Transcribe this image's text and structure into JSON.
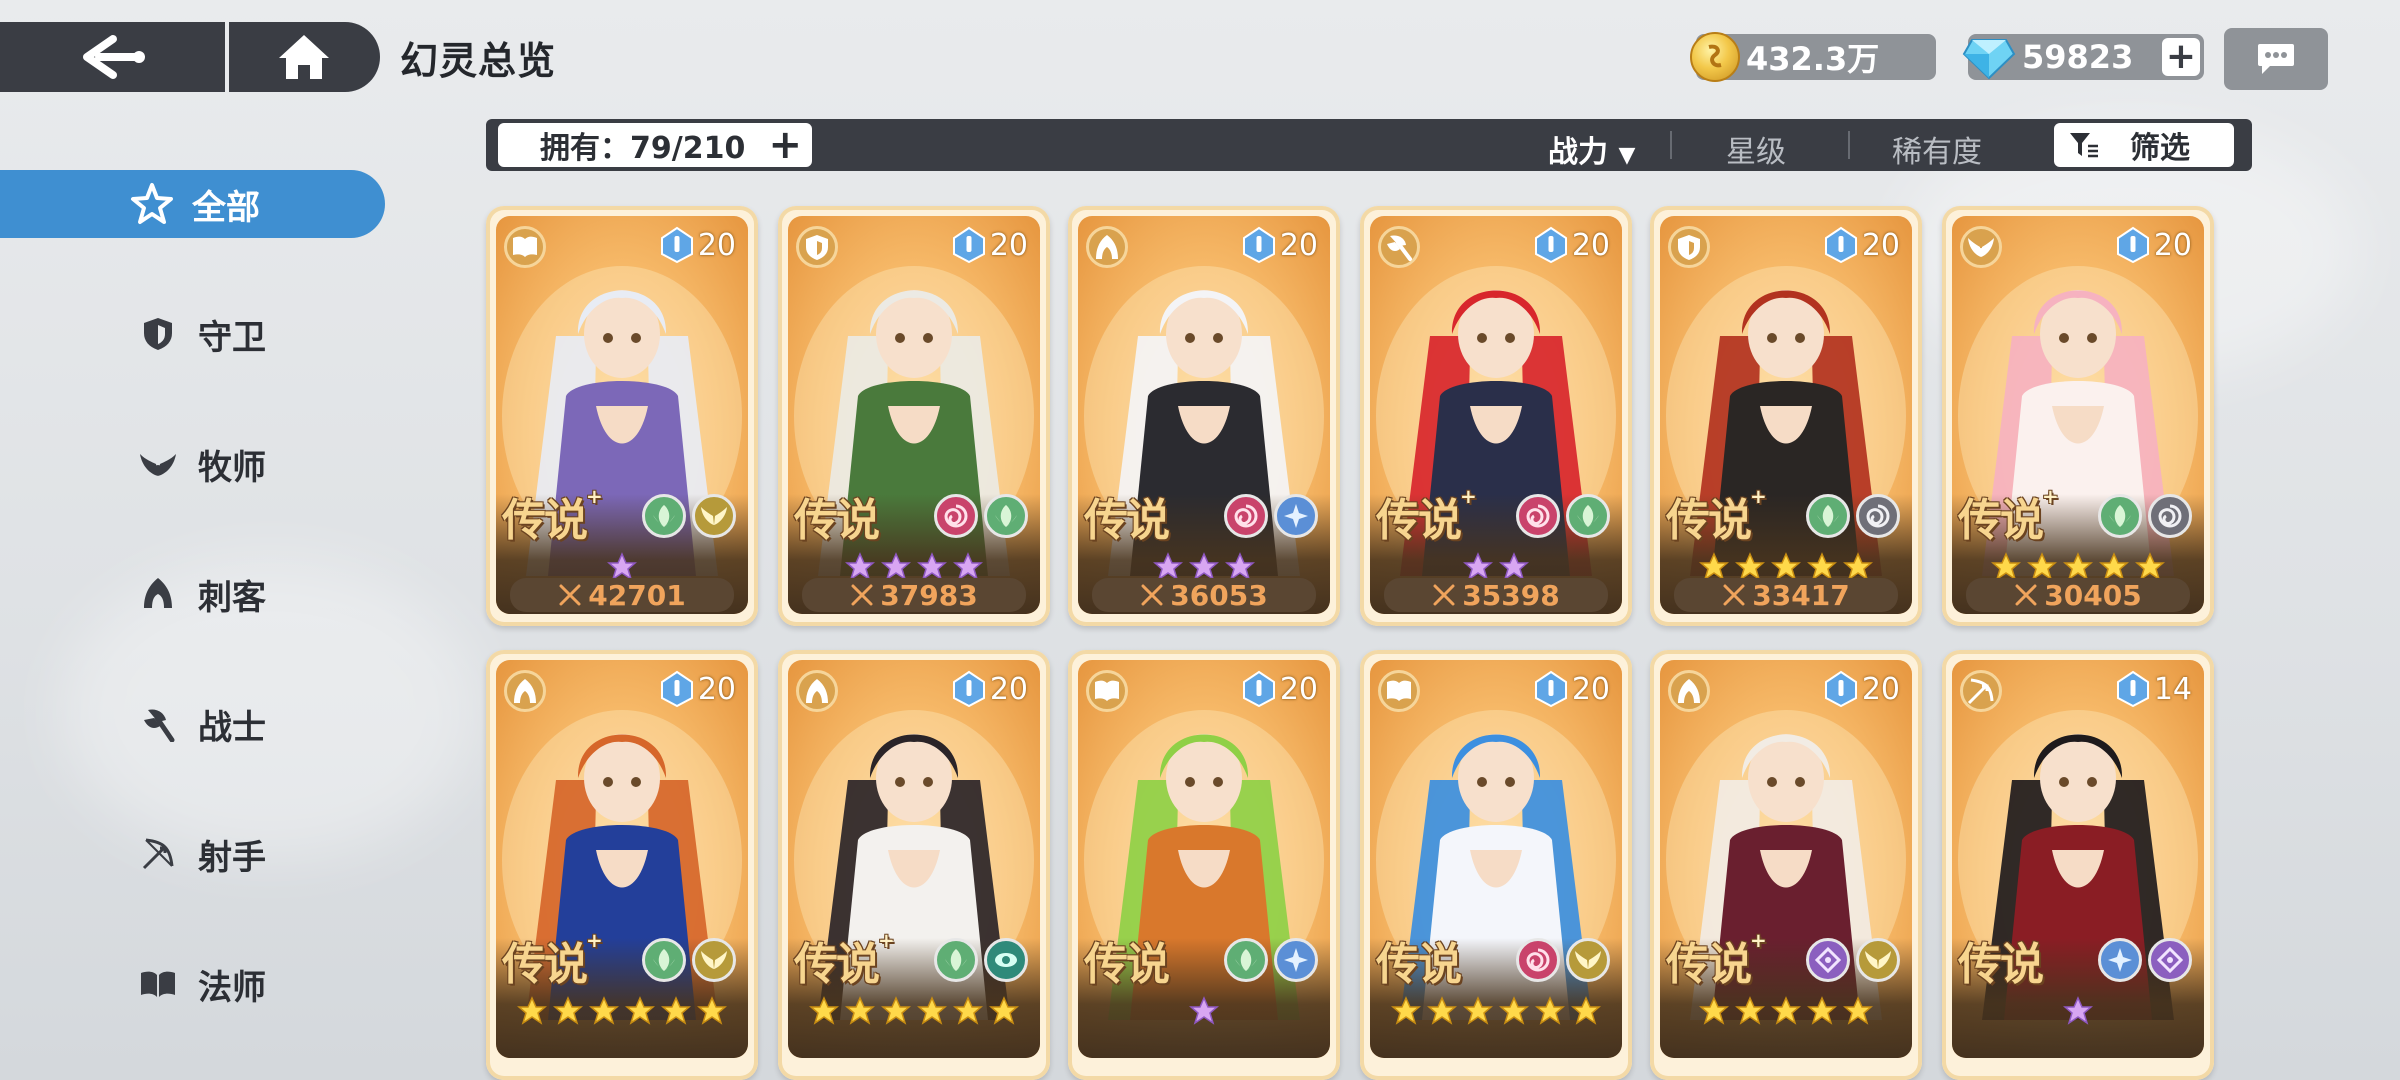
{
  "header": {
    "title": "幻灵总览",
    "coins": "432.3万",
    "gems": "59823"
  },
  "sidebar": {
    "items": [
      {
        "label": "全部",
        "icon": "all-star-icon",
        "active": true
      },
      {
        "label": "守卫",
        "icon": "shield-icon",
        "active": false
      },
      {
        "label": "牧师",
        "icon": "wings-icon",
        "active": false
      },
      {
        "label": "刺客",
        "icon": "hood-icon",
        "active": false
      },
      {
        "label": "战士",
        "icon": "axe-icon",
        "active": false
      },
      {
        "label": "射手",
        "icon": "bow-icon",
        "active": false
      },
      {
        "label": "法师",
        "icon": "book-icon",
        "active": false
      }
    ]
  },
  "filter": {
    "owned": "拥有：79/210",
    "sort_power": "战力",
    "sort_arrow": "▼",
    "sort_star": "星级",
    "sort_rarity": "稀有度",
    "filter_label": "筛选"
  },
  "colors": {
    "accent": "#3f8fd1",
    "dark": "#3a3d44",
    "card_bg": "#fdf1da",
    "power_text": "#f0a45c"
  },
  "cards": [
    {
      "class": "book-icon",
      "level": "20",
      "rarity": "传说",
      "plus": "+",
      "elements": [
        "leaf",
        "wings"
      ],
      "stars": 1,
      "star_color": "purple",
      "power": "42701",
      "hair": "#e8ecf4",
      "outfit": "#7c68b8"
    },
    {
      "class": "shield-icon",
      "level": "20",
      "rarity": "传说",
      "plus": "",
      "elements": [
        "swirl",
        "leaf"
      ],
      "stars": 4,
      "star_color": "purple",
      "power": "37983",
      "hair": "#eceae4",
      "outfit": "#4a7a3c"
    },
    {
      "class": "hood-icon",
      "level": "20",
      "rarity": "传说",
      "plus": "",
      "elements": [
        "swirl",
        "frost"
      ],
      "stars": 3,
      "star_color": "purple",
      "power": "36053",
      "hair": "#f4f4f6",
      "outfit": "#2b2b30"
    },
    {
      "class": "axe-icon",
      "level": "20",
      "rarity": "传说",
      "plus": "+",
      "elements": [
        "swirl",
        "leaf"
      ],
      "stars": 2,
      "star_color": "purple",
      "power": "35398",
      "hair": "#d8262c",
      "outfit": "#2a2f4a"
    },
    {
      "class": "shield-icon",
      "level": "20",
      "rarity": "传说",
      "plus": "+",
      "elements": [
        "leaf",
        "vortex"
      ],
      "stars": 5,
      "star_color": "gold",
      "power": "33417",
      "hair": "#b2321f",
      "outfit": "#2a2624"
    },
    {
      "class": "wings-icon",
      "level": "20",
      "rarity": "传说",
      "plus": "+",
      "elements": [
        "leaf",
        "vortex"
      ],
      "stars": 5,
      "star_color": "gold",
      "power": "30405",
      "hair": "#f6b2c0",
      "outfit": "#fbf1ee"
    },
    {
      "class": "hood-icon",
      "level": "20",
      "rarity": "传说",
      "plus": "+",
      "elements": [
        "leaf",
        "wings"
      ],
      "stars": 6,
      "star_color": "gold",
      "power": "",
      "hair": "#d6662a",
      "outfit": "#233f9a"
    },
    {
      "class": "hood-icon",
      "level": "20",
      "rarity": "传说",
      "plus": "+",
      "elements": [
        "leaf",
        "eye"
      ],
      "stars": 6,
      "star_color": "gold",
      "power": "",
      "hair": "#2a2428",
      "outfit": "#f3f1ee"
    },
    {
      "class": "book-icon",
      "level": "20",
      "rarity": "传说",
      "plus": "",
      "elements": [
        "leaf",
        "frost"
      ],
      "stars": 1,
      "star_color": "purple",
      "power": "",
      "hair": "#8fd046",
      "outfit": "#d9782c"
    },
    {
      "class": "book-icon",
      "level": "20",
      "rarity": "传说",
      "plus": "",
      "elements": [
        "swirl",
        "wings"
      ],
      "stars": 6,
      "star_color": "gold",
      "power": "",
      "hair": "#3c8fe0",
      "outfit": "#f4f6fb"
    },
    {
      "class": "hood-icon",
      "level": "20",
      "rarity": "传说",
      "plus": "+",
      "elements": [
        "diamond",
        "wings"
      ],
      "stars": 5,
      "star_color": "gold",
      "power": "",
      "hair": "#f2ece4",
      "outfit": "#6a1f2f"
    },
    {
      "class": "bow-icon",
      "level": "14",
      "rarity": "传说",
      "plus": "",
      "elements": [
        "frost",
        "diamond"
      ],
      "stars": 1,
      "star_color": "purple",
      "power": "",
      "hair": "#1e1a1c",
      "outfit": "#8a1d24"
    }
  ]
}
